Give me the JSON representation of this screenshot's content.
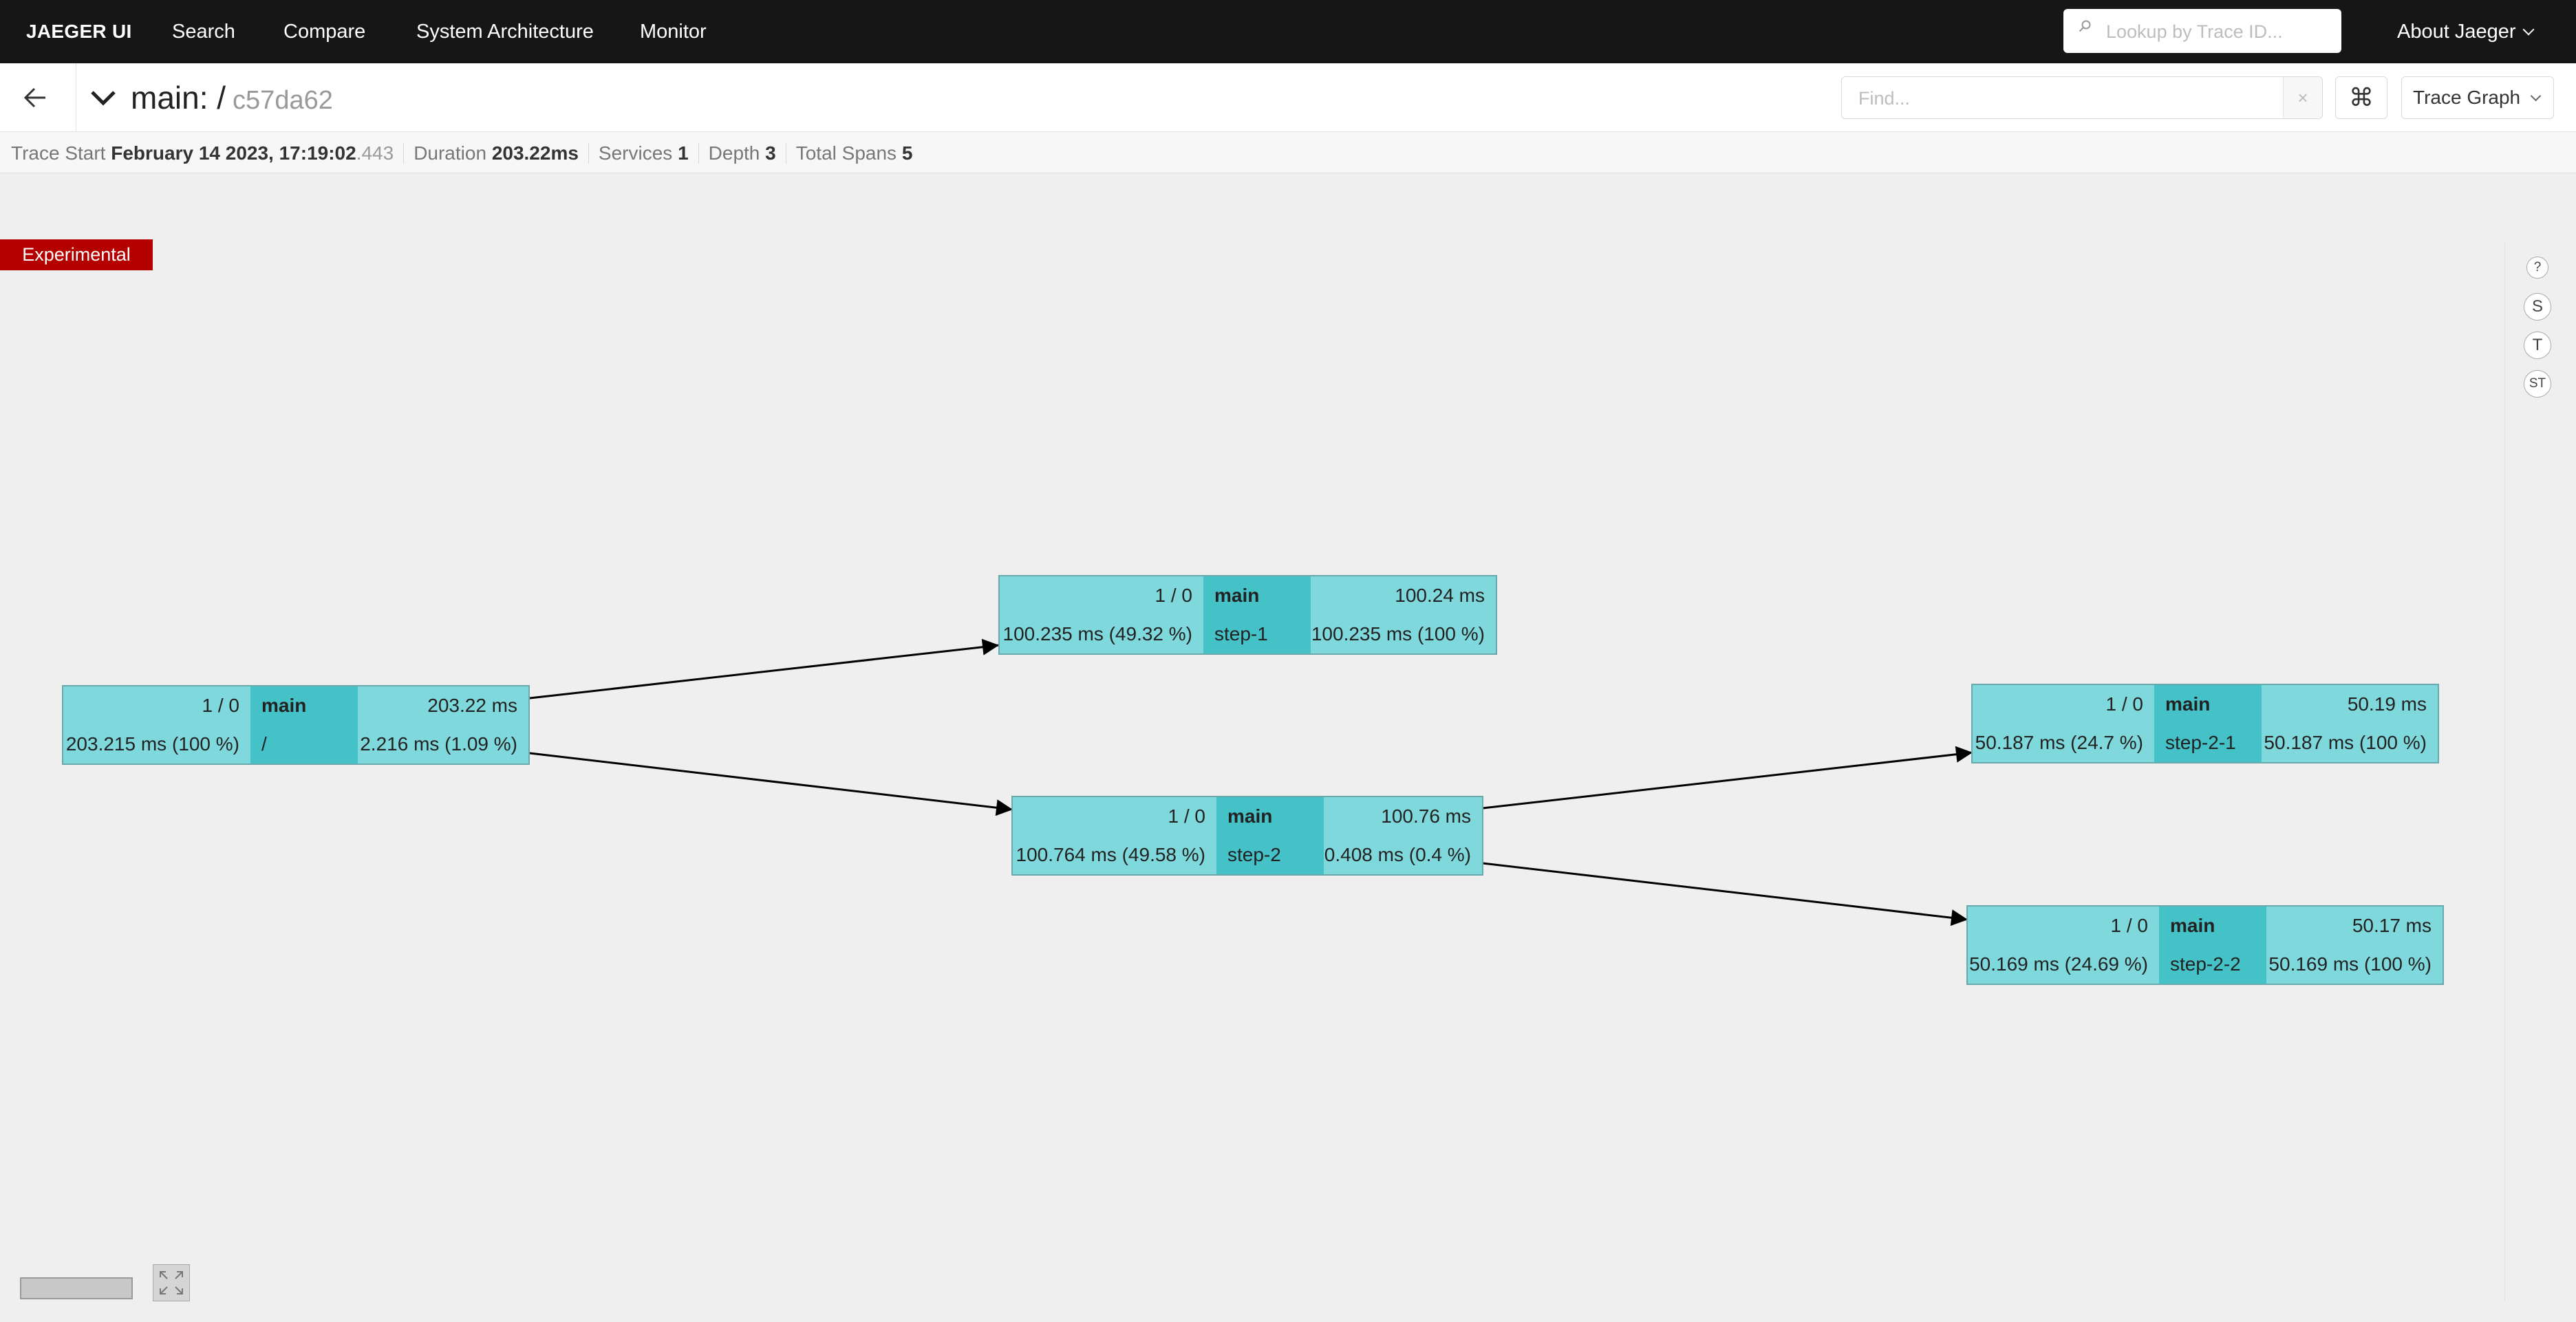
{
  "nav": {
    "brand": "JAEGER UI",
    "links": [
      "Search",
      "Compare",
      "System Architecture",
      "Monitor"
    ],
    "lookup_placeholder": "Lookup by Trace ID...",
    "about": "About Jaeger"
  },
  "trace": {
    "title": "main: /",
    "trace_id": "c57da62",
    "find_placeholder": "Find...",
    "find_clear": "×",
    "shortcut_icon": "⌘",
    "view": "Trace Graph"
  },
  "summary": {
    "start_label": "Trace Start",
    "start_value": "February 14 2023, 17:19:02",
    "start_ms": ".443",
    "duration_label": "Duration",
    "duration_value": "203.22ms",
    "services_label": "Services",
    "services_value": "1",
    "depth_label": "Depth",
    "depth_value": "3",
    "spans_label": "Total Spans",
    "spans_value": "5"
  },
  "experimental": "Experimental",
  "tools": [
    "?",
    "S",
    "T",
    "ST"
  ],
  "nodes": [
    {
      "count": "1 / 0",
      "service": "main",
      "total": "203.22 ms",
      "self_total": "203.215 ms (100 %)",
      "operation": "/",
      "self_pct": "2.216 ms (1.09 %)"
    },
    {
      "count": "1 / 0",
      "service": "main",
      "total": "100.24 ms",
      "self_total": "100.235 ms (49.32 %)",
      "operation": "step-1",
      "self_pct": "100.235 ms (100 %)"
    },
    {
      "count": "1 / 0",
      "service": "main",
      "total": "100.76 ms",
      "self_total": "100.764 ms (49.58 %)",
      "operation": "step-2",
      "self_pct": "0.408 ms (0.4 %)"
    },
    {
      "count": "1 / 0",
      "service": "main",
      "total": "50.19 ms",
      "self_total": "50.187 ms (24.7 %)",
      "operation": "step-2-1",
      "self_pct": "50.187 ms (100 %)"
    },
    {
      "count": "1 / 0",
      "service": "main",
      "total": "50.17 ms",
      "self_total": "50.169 ms (24.69 %)",
      "operation": "step-2-2",
      "self_pct": "50.169 ms (100 %)"
    }
  ]
}
